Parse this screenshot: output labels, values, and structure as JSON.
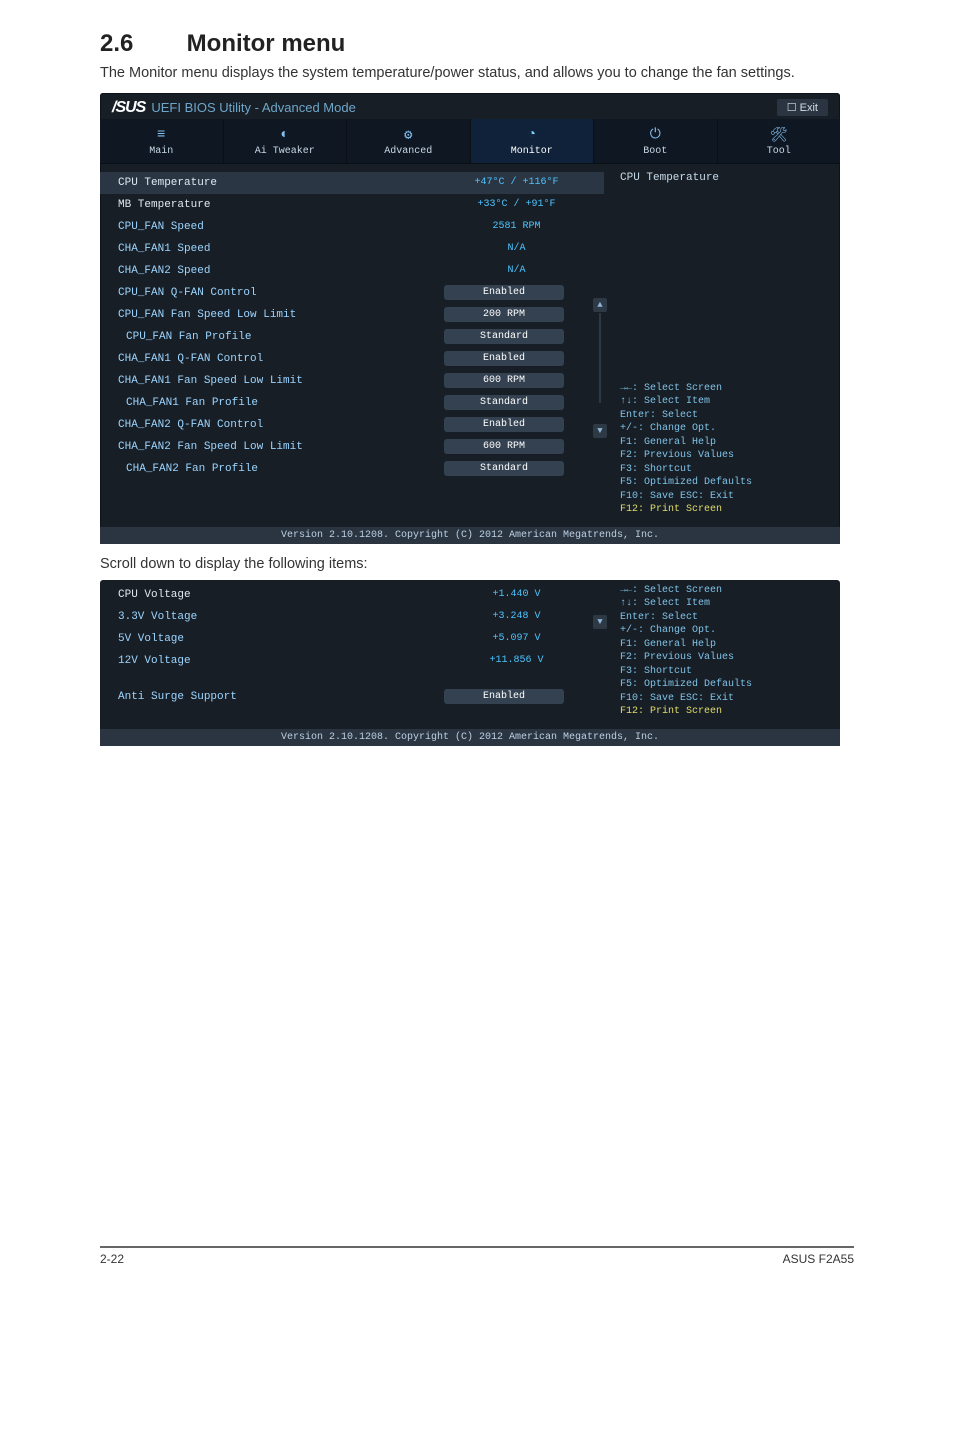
{
  "heading_num": "2.6",
  "heading_title": "Monitor menu",
  "intro": "The Monitor menu displays the system temperature/power status, and allows you to change the fan settings.",
  "titlebar": {
    "logo": "/SUS",
    "title": "UEFI BIOS Utility - Advanced Mode",
    "exit": "Exit"
  },
  "tabs": [
    {
      "label": "Main"
    },
    {
      "label": "Ai Tweaker"
    },
    {
      "label": "Advanced"
    },
    {
      "label": "Monitor"
    },
    {
      "label": "Boot"
    },
    {
      "label": "Tool"
    }
  ],
  "rows1": [
    {
      "name": "CPU Temperature",
      "val": "+47°C / +116°F",
      "type": "static",
      "sel": true
    },
    {
      "name": "MB Temperature",
      "val": "+33°C / +91°F",
      "type": "static",
      "white": true
    },
    {
      "name": "CPU_FAN Speed",
      "val": "2581 RPM",
      "type": "static"
    },
    {
      "name": "CHA_FAN1 Speed",
      "val": "N/A",
      "type": "static"
    },
    {
      "name": "CHA_FAN2 Speed",
      "val": "N/A",
      "type": "static"
    },
    {
      "name": "CPU_FAN Q-FAN Control",
      "val": "Enabled",
      "type": "pill"
    },
    {
      "name": "CPU_FAN Fan Speed Low Limit",
      "val": "200 RPM",
      "type": "pill"
    },
    {
      "name": "CPU_FAN Fan Profile",
      "val": "Standard",
      "type": "pill",
      "indent": true
    },
    {
      "name": "CHA_FAN1 Q-FAN Control",
      "val": "Enabled",
      "type": "pill"
    },
    {
      "name": "CHA_FAN1 Fan Speed Low Limit",
      "val": "600 RPM",
      "type": "pill"
    },
    {
      "name": "CHA_FAN1 Fan Profile",
      "val": "Standard",
      "type": "pill",
      "indent": true
    },
    {
      "name": "CHA_FAN2 Q-FAN Control",
      "val": "Enabled",
      "type": "pill"
    },
    {
      "name": "CHA_FAN2 Fan Speed Low Limit",
      "val": "600 RPM",
      "type": "pill"
    },
    {
      "name": "CHA_FAN2 Fan Profile",
      "val": "Standard",
      "type": "pill",
      "indent": true
    }
  ],
  "right1_title": "CPU Temperature",
  "help_lines": [
    "→←: Select Screen",
    "↑↓: Select Item",
    "Enter: Select",
    "+/-: Change Opt.",
    "F1: General Help",
    "F2: Previous Values",
    "F3: Shortcut",
    "F5: Optimized Defaults",
    "F10: Save  ESC: Exit"
  ],
  "help_last": "F12: Print Screen",
  "version_footer": "Version 2.10.1208. Copyright (C) 2012 American Megatrends, Inc.",
  "scroll_caption": "Scroll down to display the following items:",
  "rows2": [
    {
      "name": "CPU Voltage",
      "val": "+1.440 V",
      "type": "static",
      "white": true
    },
    {
      "name": "3.3V Voltage",
      "val": "+3.248 V",
      "type": "static"
    },
    {
      "name": "5V Voltage",
      "val": "+5.097 V",
      "type": "static"
    },
    {
      "name": "12V Voltage",
      "val": "+11.856 V",
      "type": "static"
    },
    {
      "name": "Anti Surge Support",
      "val": "Enabled",
      "type": "pill",
      "gap": true
    }
  ],
  "footer_left": "2-22",
  "footer_right": "ASUS F2A55"
}
